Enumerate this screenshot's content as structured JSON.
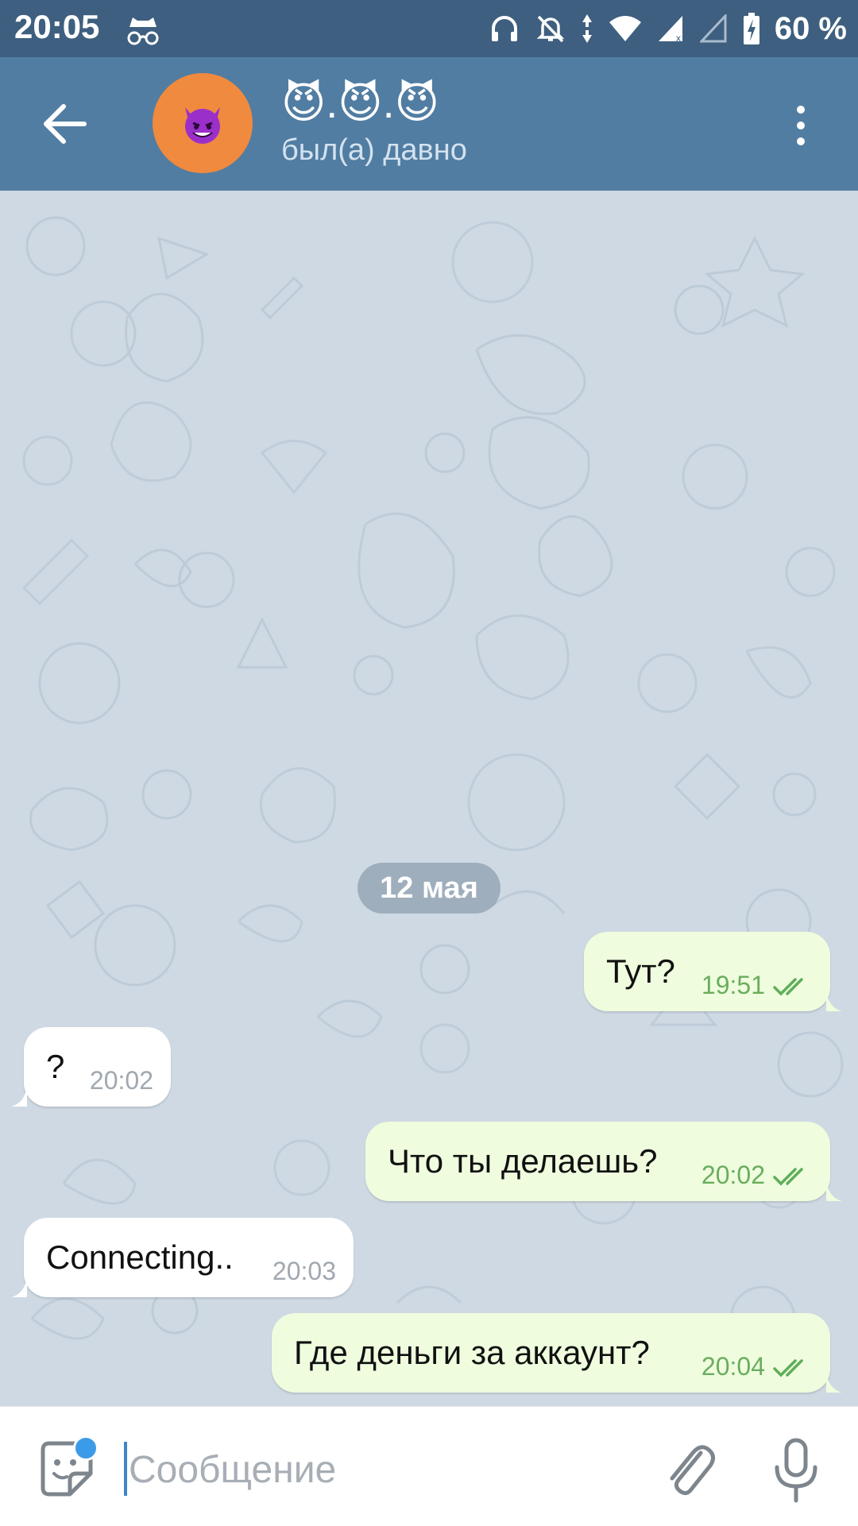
{
  "status_bar": {
    "time": "20:05",
    "battery": "60 %",
    "icons": [
      "incognito-icon",
      "headphones-icon",
      "notifications-off-icon",
      "data-arrows-icon",
      "wifi-icon",
      "signal-icon",
      "signal-empty-icon",
      "battery-charging-icon"
    ]
  },
  "header": {
    "title": "😈.😈.😈",
    "avatar_emoji": "😈",
    "status": "был(а) давно",
    "avatar_color": "#f08a3e",
    "bar_color": "#517da2"
  },
  "chat": {
    "date_separator": "12 мая",
    "messages": [
      {
        "direction": "out",
        "text": "Тут?",
        "time": "19:51",
        "read": true
      },
      {
        "direction": "in",
        "text": "?",
        "time": "20:02"
      },
      {
        "direction": "out",
        "text": "Что ты делаешь?",
        "time": "20:02",
        "read": true
      },
      {
        "direction": "in",
        "text": "Connecting..",
        "time": "20:03"
      },
      {
        "direction": "out",
        "text": "Где деньги за аккаунт?",
        "time": "20:04",
        "read": true
      }
    ],
    "out_bubble_color": "#effdde",
    "in_bubble_color": "#ffffff"
  },
  "input": {
    "placeholder": "Сообщение",
    "value": ""
  },
  "icons": {
    "back": "arrow-left-icon",
    "menu": "more-vertical-icon",
    "sticker": "sticker-icon",
    "attach": "paperclip-icon",
    "mic": "microphone-icon"
  }
}
